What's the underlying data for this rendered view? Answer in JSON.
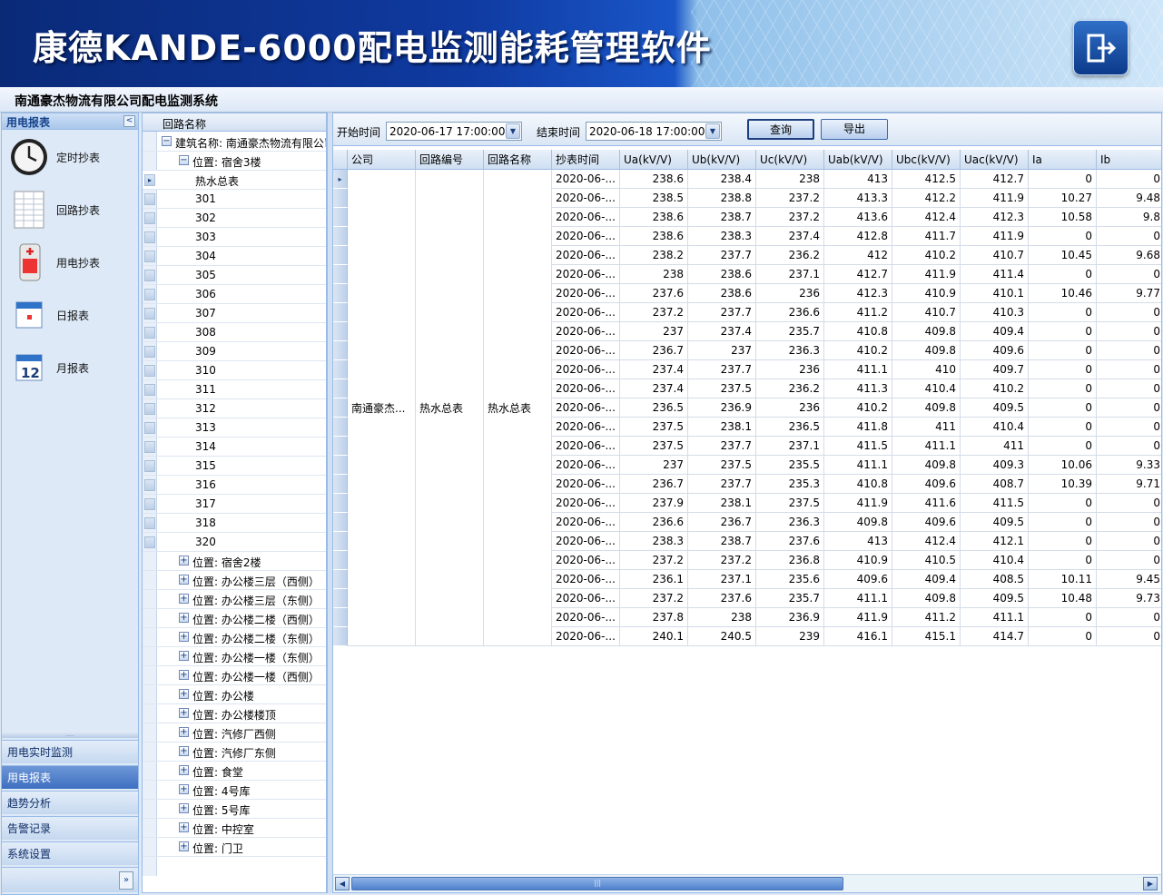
{
  "app_title": "康德KANDE-6000配电监测能耗管理软件",
  "company_title": "南通豪杰物流有限公司配电监测系统",
  "nav": {
    "header": "用电报表",
    "items": [
      {
        "label": "定时抄表",
        "icon": "clock-icon"
      },
      {
        "label": "回路抄表",
        "icon": "spreadsheet-icon"
      },
      {
        "label": "用电抄表",
        "icon": "meter-icon"
      },
      {
        "label": "日报表",
        "icon": "calendar-icon"
      },
      {
        "label": "月报表",
        "icon": "calendar-12-icon",
        "icon_text": "12"
      }
    ],
    "sections": [
      "用电实时监测",
      "用电报表",
      "趋势分析",
      "告警记录",
      "系统设置"
    ],
    "active_section": "用电报表"
  },
  "tree": {
    "header": "回路名称",
    "building": "建筑名称: 南通豪杰物流有限公司",
    "expanded_location": "位置: 宿舍3楼",
    "circuits": [
      "热水总表",
      "301",
      "302",
      "303",
      "304",
      "305",
      "306",
      "307",
      "308",
      "309",
      "310",
      "311",
      "312",
      "313",
      "314",
      "315",
      "316",
      "317",
      "318",
      "320"
    ],
    "selected": "热水总表",
    "collapsed_locations": [
      "位置: 宿舍2楼",
      "位置: 办公楼三层（西侧）",
      "位置: 办公楼三层（东侧）",
      "位置: 办公楼二楼（西侧）",
      "位置: 办公楼二楼（东侧）",
      "位置: 办公楼一楼（东侧）",
      "位置: 办公楼一楼（西侧）",
      "位置: 办公楼",
      "位置: 办公楼楼顶",
      "位置: 汽修厂西侧",
      "位置: 汽修厂东侧",
      "位置: 食堂",
      "位置: 4号库",
      "位置: 5号库",
      "位置: 中控室",
      "位置: 门卫"
    ]
  },
  "toolbar": {
    "start_label": "开始时间",
    "start_value": "2020-06-17 17:00:00",
    "end_label": "结束时间",
    "end_value": "2020-06-18 17:00:00",
    "query_label": "查询",
    "export_label": "导出"
  },
  "grid": {
    "columns": [
      "公司",
      "回路编号",
      "回路名称",
      "抄表时间",
      "Ua(kV/V)",
      "Ub(kV/V)",
      "Uc(kV/V)",
      "Uab(kV/V)",
      "Ubc(kV/V)",
      "Uac(kV/V)",
      "Ia",
      "Ib"
    ],
    "company": "南通豪杰...",
    "circuit_no": "热水总表",
    "circuit_name": "热水总表",
    "time_display": "2020-06-...",
    "rows": [
      [
        "238.6",
        "238.4",
        "238",
        "413",
        "412.5",
        "412.7",
        "0",
        "0"
      ],
      [
        "238.5",
        "238.8",
        "237.2",
        "413.3",
        "412.2",
        "411.9",
        "10.27",
        "9.48"
      ],
      [
        "238.6",
        "238.7",
        "237.2",
        "413.6",
        "412.4",
        "412.3",
        "10.58",
        "9.8"
      ],
      [
        "238.6",
        "238.3",
        "237.4",
        "412.8",
        "411.7",
        "411.9",
        "0",
        "0"
      ],
      [
        "238.2",
        "237.7",
        "236.2",
        "412",
        "410.2",
        "410.7",
        "10.45",
        "9.68"
      ],
      [
        "238",
        "238.6",
        "237.1",
        "412.7",
        "411.9",
        "411.4",
        "0",
        "0"
      ],
      [
        "237.6",
        "238.6",
        "236",
        "412.3",
        "410.9",
        "410.1",
        "10.46",
        "9.77"
      ],
      [
        "237.2",
        "237.7",
        "236.6",
        "411.2",
        "410.7",
        "410.3",
        "0",
        "0"
      ],
      [
        "237",
        "237.4",
        "235.7",
        "410.8",
        "409.8",
        "409.4",
        "0",
        "0"
      ],
      [
        "236.7",
        "237",
        "236.3",
        "410.2",
        "409.8",
        "409.6",
        "0",
        "0"
      ],
      [
        "237.4",
        "237.7",
        "236",
        "411.1",
        "410",
        "409.7",
        "0",
        "0"
      ],
      [
        "237.4",
        "237.5",
        "236.2",
        "411.3",
        "410.4",
        "410.2",
        "0",
        "0"
      ],
      [
        "236.5",
        "236.9",
        "236",
        "410.2",
        "409.8",
        "409.5",
        "0",
        "0"
      ],
      [
        "237.5",
        "238.1",
        "236.5",
        "411.8",
        "411",
        "410.4",
        "0",
        "0"
      ],
      [
        "237.5",
        "237.7",
        "237.1",
        "411.5",
        "411.1",
        "411",
        "0",
        "0"
      ],
      [
        "237",
        "237.5",
        "235.5",
        "411.1",
        "409.8",
        "409.3",
        "10.06",
        "9.33"
      ],
      [
        "236.7",
        "237.7",
        "235.3",
        "410.8",
        "409.6",
        "408.7",
        "10.39",
        "9.71"
      ],
      [
        "237.9",
        "238.1",
        "237.5",
        "411.9",
        "411.6",
        "411.5",
        "0",
        "0"
      ],
      [
        "236.6",
        "236.7",
        "236.3",
        "409.8",
        "409.6",
        "409.5",
        "0",
        "0"
      ],
      [
        "238.3",
        "238.7",
        "237.6",
        "413",
        "412.4",
        "412.1",
        "0",
        "0"
      ],
      [
        "237.2",
        "237.2",
        "236.8",
        "410.9",
        "410.5",
        "410.4",
        "0",
        "0"
      ],
      [
        "236.1",
        "237.1",
        "235.6",
        "409.6",
        "409.4",
        "408.5",
        "10.11",
        "9.45"
      ],
      [
        "237.2",
        "237.6",
        "235.7",
        "411.1",
        "409.8",
        "409.5",
        "10.48",
        "9.73"
      ],
      [
        "237.8",
        "238",
        "236.9",
        "411.9",
        "411.2",
        "411.1",
        "0",
        "0"
      ],
      [
        "240.1",
        "240.5",
        "239",
        "416.1",
        "415.1",
        "414.7",
        "0",
        "0"
      ]
    ]
  },
  "colors": {
    "header_dark": "#0a2a78",
    "nav_active": "#3e6fc1",
    "border": "#99bbe8"
  }
}
